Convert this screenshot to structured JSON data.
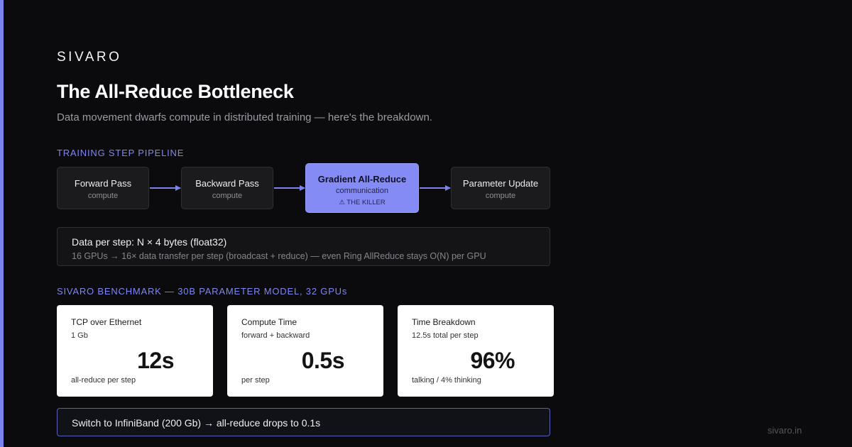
{
  "colors": {
    "background": "#0b0b0d",
    "accent": "#7f86f2",
    "highlight_stage": "#848bf4",
    "card_background": "#ffffff"
  },
  "brand": "SIVARO",
  "title": "The All-Reduce Bottleneck",
  "subtitle": "Data movement dwarfs compute in distributed training — here's the breakdown.",
  "pipeline": {
    "label": "TRAINING STEP PIPELINE",
    "stages": [
      {
        "name": "Forward Pass",
        "type": "compute"
      },
      {
        "name": "Backward Pass",
        "type": "compute"
      },
      {
        "name": "Gradient All-Reduce",
        "type": "communication",
        "warning": "⚠ THE KILLER",
        "highlighted": true
      },
      {
        "name": "Parameter Update",
        "type": "compute"
      }
    ],
    "flow": [
      "Forward Pass",
      "Backward Pass",
      "Gradient All-Reduce",
      "Parameter Update"
    ]
  },
  "data_box": {
    "main": "Data per step: N × 4 bytes (float32)",
    "note": "16 GPUs → 16× data transfer per step (broadcast + reduce) — even Ring AllReduce stays O(N) per GPU"
  },
  "benchmark": {
    "label": "SIVARO BENCHMARK — 30B PARAMETER MODEL, 32 GPUs",
    "cards": [
      {
        "title": "TCP over Ethernet",
        "sub": "1 Gb",
        "value": "12s",
        "foot": "all-reduce per step"
      },
      {
        "title": "Compute Time",
        "sub": "forward + backward",
        "value": "0.5s",
        "foot": "per step"
      },
      {
        "title": "Time Breakdown",
        "sub": "12.5s total per step",
        "value": "96%",
        "foot": "talking / 4% thinking"
      }
    ]
  },
  "callout": "Switch to InfiniBand (200 Gb) → all-reduce drops to 0.1s",
  "footer_url": "sivaro.in"
}
